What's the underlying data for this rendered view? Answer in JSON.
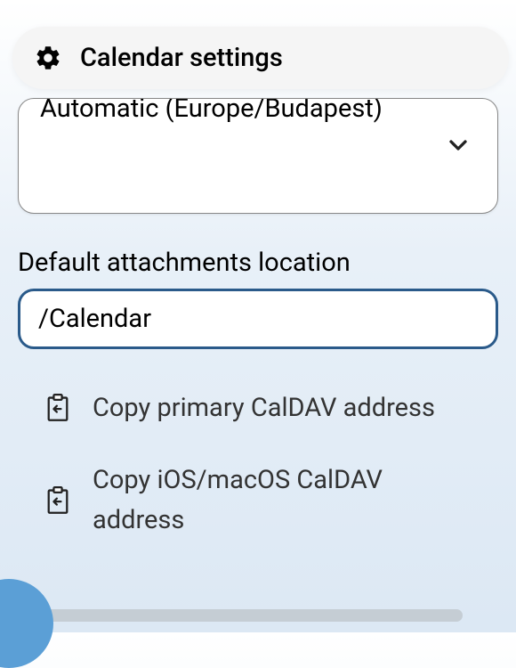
{
  "header": {
    "title": "Calendar settings"
  },
  "timezone_dropdown": {
    "value": "Automatic (Europe/Budapest)"
  },
  "attachments": {
    "label": "Default attachments location",
    "value": "/Calendar"
  },
  "actions": {
    "copy_primary": "Copy primary CalDAV address",
    "copy_ios": "Copy iOS/macOS CalDAV address"
  }
}
